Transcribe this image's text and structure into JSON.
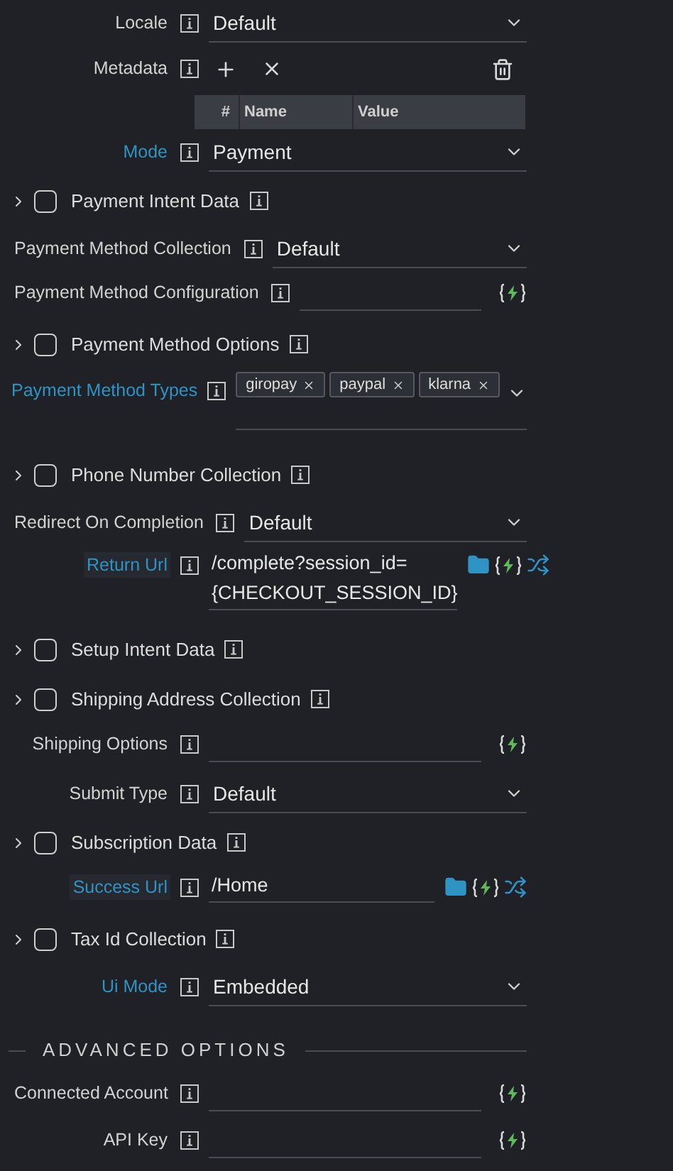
{
  "rows": [
    {
      "kind": "select",
      "label": "Locale",
      "highlighted": false,
      "value": "Default"
    },
    {
      "kind": "metadata",
      "label": "Metadata",
      "highlighted": false,
      "columns": [
        "#",
        "Name",
        "Value"
      ]
    },
    {
      "kind": "select",
      "label": "Mode",
      "highlighted": true,
      "value": "Payment"
    },
    {
      "kind": "group",
      "label": "Payment Intent Data",
      "checked": false,
      "expanded": false
    },
    {
      "kind": "select",
      "label": "Payment Method Collection",
      "highlighted": false,
      "value": "Default"
    },
    {
      "kind": "text",
      "label": "Payment Method Configuration",
      "highlighted": false,
      "folder": false,
      "shuffle": false
    },
    {
      "kind": "group",
      "label": "Payment Method Options",
      "checked": false,
      "expanded": false
    },
    {
      "kind": "tags",
      "label": "Payment Method Types",
      "highlighted": true,
      "tags": [
        "giropay",
        "paypal",
        "klarna"
      ]
    },
    {
      "kind": "group",
      "label": "Phone Number Collection",
      "checked": false,
      "expanded": false
    },
    {
      "kind": "select",
      "label": "Redirect On Completion",
      "highlighted": false,
      "value": "Default"
    },
    {
      "kind": "text",
      "label": "Return Url",
      "highlighted": true,
      "value_lines": [
        "/complete?session_id=",
        "{CHECKOUT_SESSION_ID}"
      ],
      "folder": true,
      "shuffle": true
    },
    {
      "kind": "group",
      "label": "Setup Intent Data",
      "checked": false,
      "expanded": false
    },
    {
      "kind": "group",
      "label": "Shipping Address Collection",
      "checked": false,
      "expanded": false
    },
    {
      "kind": "text",
      "label": "Shipping Options",
      "highlighted": false,
      "folder": false,
      "shuffle": false
    },
    {
      "kind": "select",
      "label": "Submit Type",
      "highlighted": false,
      "value": "Default"
    },
    {
      "kind": "group",
      "label": "Subscription Data",
      "checked": false,
      "expanded": false
    },
    {
      "kind": "text",
      "label": "Success Url",
      "highlighted": true,
      "value_lines": [
        "/Home"
      ],
      "folder": true,
      "shuffle": true
    },
    {
      "kind": "group",
      "label": "Tax Id Collection",
      "checked": false,
      "expanded": false
    },
    {
      "kind": "select",
      "label": "Ui Mode",
      "highlighted": true,
      "value": "Embedded"
    },
    {
      "kind": "section",
      "title": "ADVANCED OPTIONS"
    },
    {
      "kind": "text",
      "label": "Connected Account",
      "highlighted": false,
      "folder": false,
      "shuffle": false
    },
    {
      "kind": "text",
      "label": "API Key",
      "highlighted": false,
      "folder": false,
      "shuffle": false
    }
  ]
}
